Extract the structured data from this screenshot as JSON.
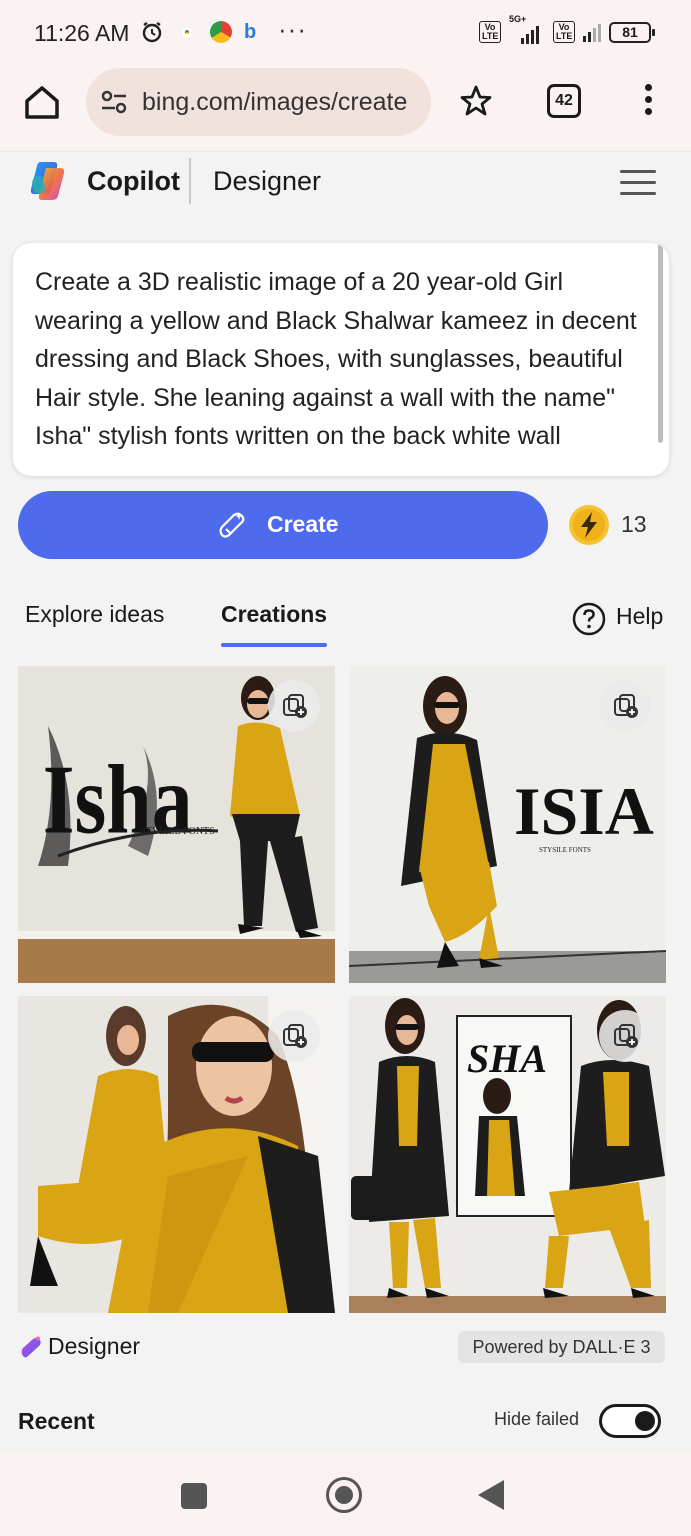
{
  "status_bar": {
    "time": "11:26 AM",
    "icons": [
      "alarm-icon",
      "chrome-icon",
      "chrome-icon",
      "bing-icon"
    ],
    "more": "···",
    "network": "5G+",
    "volte": "Vo LTE",
    "battery": "81"
  },
  "browser": {
    "url": "bing.com/images/create",
    "tab_count": "42"
  },
  "header": {
    "brand": "Copilot",
    "product": "Designer"
  },
  "prompt": {
    "text": "Create a 3D realistic image of a 20 year-old Girl wearing a yellow and Black Shalwar kameez in decent dressing and Black Shoes, with sunglasses, beautiful Hair style. She leaning against a wall with the name\" Isha\" stylish fonts written on the back white wall"
  },
  "create": {
    "label": "Create",
    "boost_count": "13"
  },
  "tabs": {
    "explore": "Explore ideas",
    "creations": "Creations",
    "active": "Creations",
    "help": "Help"
  },
  "images": [
    {
      "name": "generated-image-1",
      "wall_text": "Isha",
      "sub_text": "STYLILE FONTS"
    },
    {
      "name": "generated-image-2",
      "wall_text": "ISIA",
      "sub_text": "STYSILE FONTS"
    },
    {
      "name": "generated-image-3"
    },
    {
      "name": "generated-image-4",
      "wall_text": "SHA"
    }
  ],
  "footer": {
    "designer": "Designer",
    "powered_by": "Powered by DALL·E 3",
    "recent": "Recent",
    "hide_failed": "Hide failed",
    "hide_failed_on": true
  },
  "colors": {
    "accent": "#4f6bed",
    "chrome_bg": "#fbf3f1",
    "mustard": "#d9a514",
    "black_outfit": "#1d1d1d"
  }
}
